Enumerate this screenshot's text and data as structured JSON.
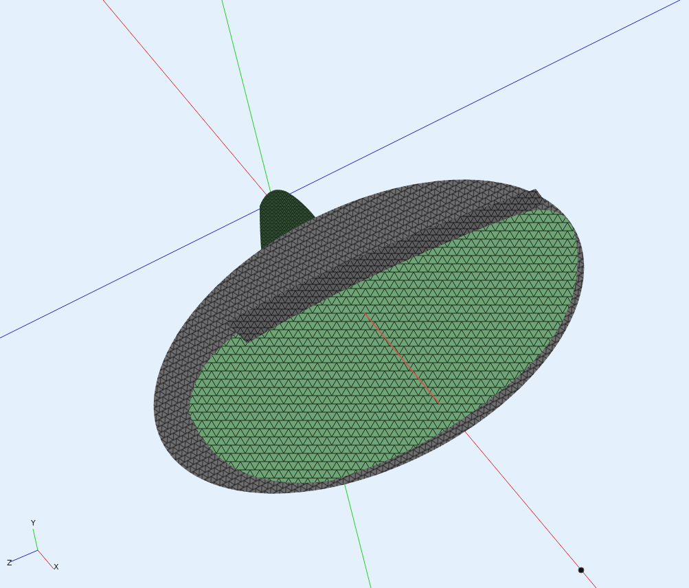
{
  "viewport": {
    "axis_triad": {
      "labels": [
        "Y",
        "Z",
        "X"
      ]
    }
  }
}
